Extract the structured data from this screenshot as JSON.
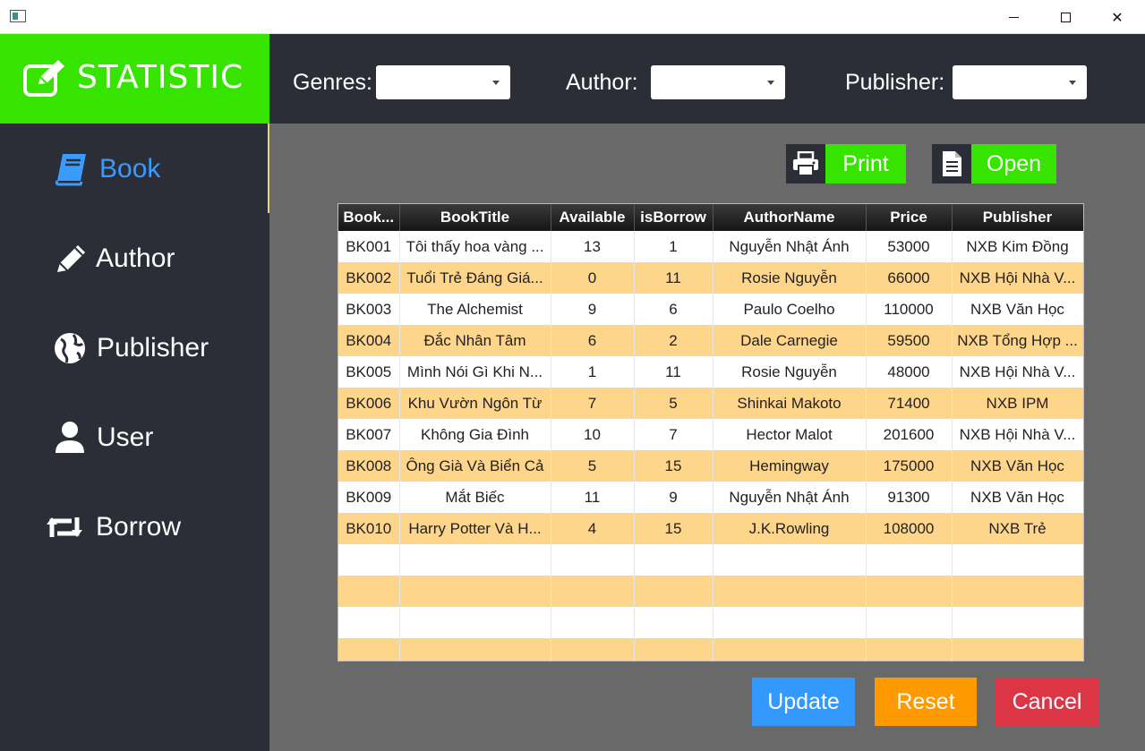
{
  "window": {
    "controls": {
      "minimize": "minimize",
      "maximize": "maximize",
      "close": "✕"
    }
  },
  "brand": {
    "title": "STATISTIC",
    "icon": "edit-square-icon"
  },
  "sidebar": {
    "items": [
      {
        "label": "Book",
        "icon": "book-icon",
        "active": true
      },
      {
        "label": "Author",
        "icon": "pencil-icon",
        "active": false
      },
      {
        "label": "Publisher",
        "icon": "globe-icon",
        "active": false
      },
      {
        "label": "User",
        "icon": "user-icon",
        "active": false
      },
      {
        "label": "Borrow",
        "icon": "retweet-icon",
        "active": false
      }
    ]
  },
  "filters": {
    "genres": {
      "label": "Genres:",
      "value": ""
    },
    "author": {
      "label": "Author:",
      "value": ""
    },
    "publisher": {
      "label": "Publisher:",
      "value": ""
    }
  },
  "actions": {
    "print": {
      "label": "Print",
      "icon": "printer-icon"
    },
    "open": {
      "label": "Open",
      "icon": "document-icon"
    }
  },
  "table": {
    "columns": [
      "Book...",
      "BookTitle",
      "Available",
      "isBorrow",
      "AuthorName",
      "Price",
      "Publisher"
    ],
    "rows": [
      [
        "BK001",
        "Tôi thấy hoa vàng ...",
        "13",
        "1",
        "Nguyễn Nhật Ánh",
        "53000",
        "NXB Kim Đồng"
      ],
      [
        "BK002",
        "Tuổi Trẻ Đáng Giá...",
        "0",
        "11",
        "Rosie Nguyễn",
        "66000",
        "NXB Hội Nhà V..."
      ],
      [
        "BK003",
        "The Alchemist",
        "9",
        "6",
        "Paulo Coelho",
        "110000",
        "NXB Văn Học"
      ],
      [
        "BK004",
        "Đắc Nhân Tâm",
        "6",
        "2",
        "Dale Carnegie",
        "59500",
        "NXB Tổng Hợp ..."
      ],
      [
        "BK005",
        "Mình Nói Gì Khi N...",
        "1",
        "11",
        "Rosie Nguyễn",
        "48000",
        "NXB Hội Nhà V..."
      ],
      [
        "BK006",
        "Khu Vườn Ngôn Từ",
        "7",
        "5",
        "Shinkai Makoto",
        "71400",
        "NXB IPM"
      ],
      [
        "BK007",
        "Không Gia Đình",
        "10",
        "7",
        "Hector Malot",
        "201600",
        "NXB Hội Nhà V..."
      ],
      [
        "BK008",
        "Ông Già Và Biển Cả",
        "5",
        "15",
        "Hemingway",
        "175000",
        "NXB Văn Học"
      ],
      [
        "BK009",
        "Mắt Biếc",
        "11",
        "9",
        "Nguyễn Nhật Ánh",
        "91300",
        "NXB Văn Học"
      ],
      [
        "BK010",
        "Harry Potter Và H...",
        "4",
        "15",
        "J.K.Rowling",
        "108000",
        "NXB Trẻ"
      ]
    ],
    "empty_rows": 4
  },
  "buttons": {
    "update": {
      "label": "Update",
      "color": "#3399ff"
    },
    "reset": {
      "label": "Reset",
      "color": "#ff9900"
    },
    "cancel": {
      "label": "Cancel",
      "color": "#dc3545"
    }
  },
  "colors": {
    "accent": "#36e400",
    "sidebar": "#2b2e37",
    "main": "#696969",
    "row_alt": "#fdd58b",
    "active_nav": "#3a9bff"
  }
}
